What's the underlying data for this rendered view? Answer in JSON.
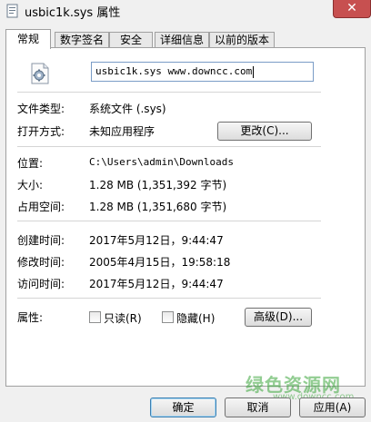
{
  "window": {
    "title": "usbic1k.sys 属性",
    "close_glyph": "✕",
    "icon": "file-properties-icon"
  },
  "tabs": [
    {
      "label": "常规",
      "active": true
    },
    {
      "label": "数字签名",
      "active": false
    },
    {
      "label": "安全",
      "active": false
    },
    {
      "label": "详细信息",
      "active": false
    },
    {
      "label": "以前的版本",
      "active": false
    }
  ],
  "general": {
    "file_icon": "system-file-gear-icon",
    "file_name": "usbic1k.sys  www.downcc.com",
    "file_type_label": "文件类型:",
    "file_type_value": "系统文件 (.sys)",
    "opens_with_label": "打开方式:",
    "opens_with_value": "未知应用程序",
    "change_button": "更改(C)...",
    "location_label": "位置:",
    "location_value": "C:\\Users\\admin\\Downloads",
    "size_label": "大小:",
    "size_value": "1.28 MB (1,351,392 字节)",
    "size_on_disk_label": "占用空间:",
    "size_on_disk_value": "1.28 MB (1,351,680 字节)",
    "created_label": "创建时间:",
    "created_value": "2017年5月12日，9:44:47",
    "modified_label": "修改时间:",
    "modified_value": "2005年4月15日，19:58:18",
    "accessed_label": "访问时间:",
    "accessed_value": "2017年5月12日，9:44:47",
    "attributes_label": "属性:",
    "readonly_label": "只读(R)",
    "hidden_label": "隐藏(H)",
    "advanced_button": "高级(D)..."
  },
  "footer": {
    "ok_button": "确定",
    "cancel_button": "取消",
    "apply_button": "应用(A)"
  },
  "watermark": {
    "text": "绿色资源网",
    "sub": "www.downcc.com"
  },
  "colors": {
    "close_button": "#c75050",
    "watermark": "#3aa63a",
    "input_border": "#7a9cc6"
  }
}
